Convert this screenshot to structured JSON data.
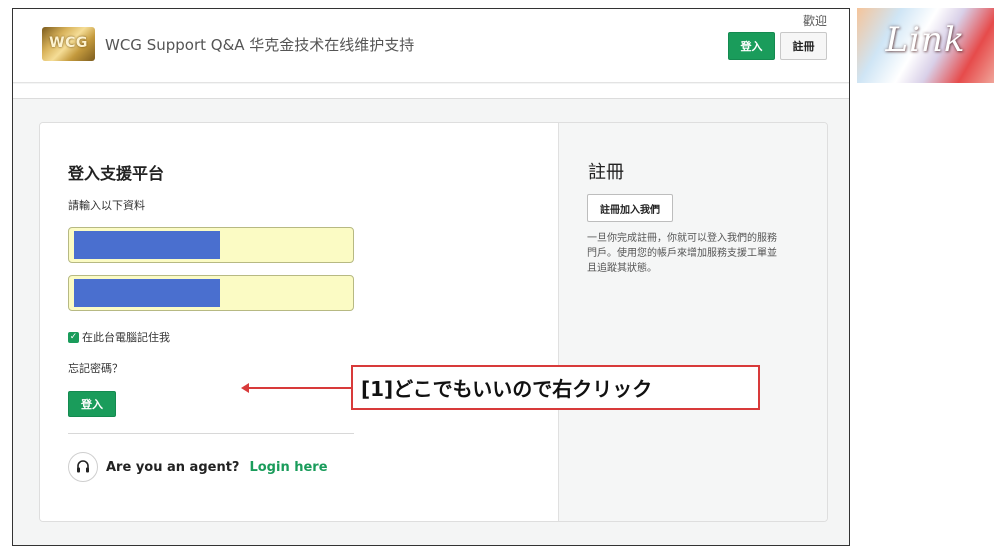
{
  "header": {
    "logo_text": "WCG",
    "site_title": "WCG Support Q&A 华克金技术在线维护支持",
    "welcome": "歡迎",
    "login_button": "登入",
    "register_button": "註冊"
  },
  "login": {
    "title": "登入支援平台",
    "subtitle": "請輸入以下資料",
    "remember_label": "在此台電腦記住我",
    "remember_checked": true,
    "forgot_link": "忘記密碼？",
    "submit_button": "登入",
    "agent_question": "Are you an agent?",
    "agent_link": "Login here"
  },
  "register": {
    "title": "註冊",
    "join_button": "註冊加入我們",
    "description": "一旦你完成註冊，你就可以登入我們的服務門戶。使用您的帳戶來增加服務支援工單並且追蹤其狀態。"
  },
  "annotation": {
    "text": "[1]どこでもいいので右クリック",
    "color": "#d83a3a"
  },
  "brand_logo": {
    "text": "Link"
  },
  "colors": {
    "accent": "#1a9c5b",
    "field_bg": "#fbfbc4",
    "mask": "#4a6fcf"
  },
  "icons": {
    "agent": "headset-icon",
    "checkbox": "check-icon"
  }
}
